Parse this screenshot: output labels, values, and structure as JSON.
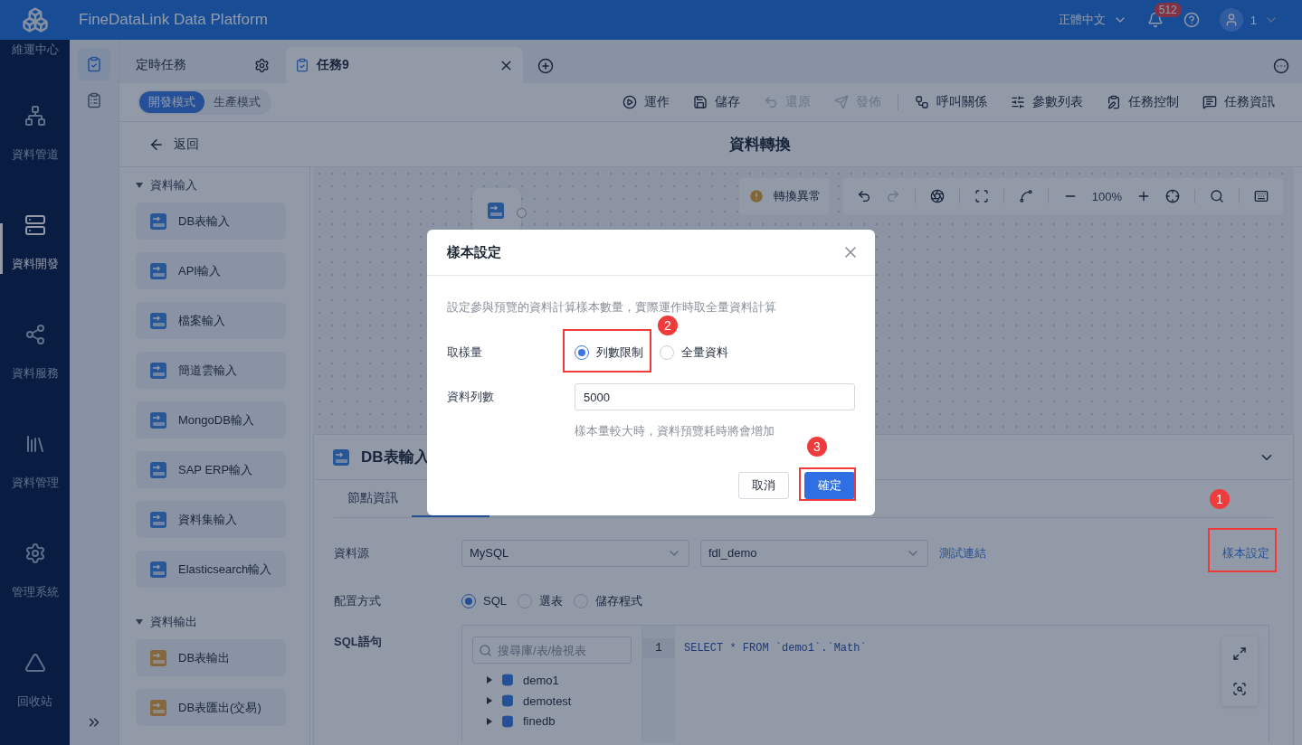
{
  "topbar": {
    "title": "FineDataLink Data Platform",
    "language": "正體中文",
    "notifications": "512",
    "user": "1"
  },
  "nav": {
    "items": [
      {
        "label": "維運中心",
        "selected": false
      },
      {
        "label": "資料管道",
        "selected": false
      },
      {
        "label": "資料開發",
        "selected": true
      },
      {
        "label": "資料服務",
        "selected": false
      },
      {
        "label": "資料管理",
        "selected": false
      },
      {
        "label": "管理系統",
        "selected": false
      },
      {
        "label": "回收站",
        "selected": false
      }
    ]
  },
  "side_tools": [
    {
      "selected": true
    },
    {
      "selected": false
    }
  ],
  "tabs": [
    {
      "label": "定時任務",
      "kind": "settings",
      "selected": false
    },
    {
      "label": "任務9",
      "kind": "task",
      "selected": true
    }
  ],
  "modes": [
    {
      "label": "開發模式",
      "selected": true
    },
    {
      "label": "生產模式",
      "selected": false
    }
  ],
  "actions": [
    {
      "label": "運作",
      "disabled": false
    },
    {
      "label": "儲存",
      "disabled": false
    },
    {
      "label": "還原",
      "disabled": true
    },
    {
      "label": "發佈",
      "disabled": true
    },
    {
      "label": "呼叫關係",
      "disabled": false
    },
    {
      "label": "參數列表",
      "disabled": false
    },
    {
      "label": "任務控制",
      "disabled": false
    },
    {
      "label": "任務資訊",
      "disabled": false
    }
  ],
  "header": {
    "back": "返回",
    "title": "資料轉換"
  },
  "palette": {
    "groups": [
      {
        "label": "資料輸入",
        "expanded": true,
        "items": [
          {
            "label": "DB表輸入"
          },
          {
            "label": "API輸入"
          },
          {
            "label": "檔案輸入"
          },
          {
            "label": "簡道雲輸入"
          },
          {
            "label": "MongoDB輸入"
          },
          {
            "label": "SAP ERP輸入"
          },
          {
            "label": "資料集輸入"
          },
          {
            "label": "Elasticsearch輸入"
          }
        ]
      },
      {
        "label": "資料輸出",
        "expanded": true,
        "items": [
          {
            "label": "DB表輸出"
          },
          {
            "label": "DB表匯出(交易)"
          }
        ]
      }
    ]
  },
  "canvas": {
    "warning": "轉換異常",
    "zoom": "100%"
  },
  "node_panel": {
    "title": "DB表輸入",
    "tabs": [
      {
        "label": "節點資訊",
        "selected": false
      },
      {
        "selected": true
      }
    ],
    "source_label": "資料源",
    "source": "MySQL",
    "database": "fdl_demo",
    "test_link": "測試連結",
    "sample_link": "樣本設定",
    "mode_label": "配置方式",
    "modes": [
      {
        "label": "SQL",
        "selected": true
      },
      {
        "label": "選表",
        "selected": false
      },
      {
        "label": "儲存程式",
        "selected": false
      }
    ],
    "sql_label": "SQL語句",
    "search": {
      "placeholder": "搜尋庫/表/檢視表"
    },
    "tree": [
      {
        "label": "demo1",
        "expanded": false
      },
      {
        "label": "demotest",
        "expanded": false
      },
      {
        "label": "finedb",
        "expanded": false
      }
    ],
    "code": [
      {
        "line": "1",
        "text": "SELECT * FROM `demo1`.`Math`"
      }
    ]
  },
  "modal": {
    "title": "樣本設定",
    "description": "設定參與預覽的資料計算樣本數量，實際運作時取全量資料計算",
    "sample_label": "取樣量",
    "options": [
      {
        "label": "列數限制",
        "selected": true
      },
      {
        "label": "全量資料",
        "selected": false
      }
    ],
    "rows_label": "資料列數",
    "rows_value": "5000",
    "hint": "樣本量較大時，資料預覽耗時將會增加",
    "buttons": [
      {
        "label": "取消",
        "kind": "secondary"
      },
      {
        "label": "確定",
        "kind": "primary"
      }
    ]
  },
  "annotations": [
    {
      "label": "2"
    },
    {
      "label": "3"
    },
    {
      "label": "1"
    }
  ]
}
